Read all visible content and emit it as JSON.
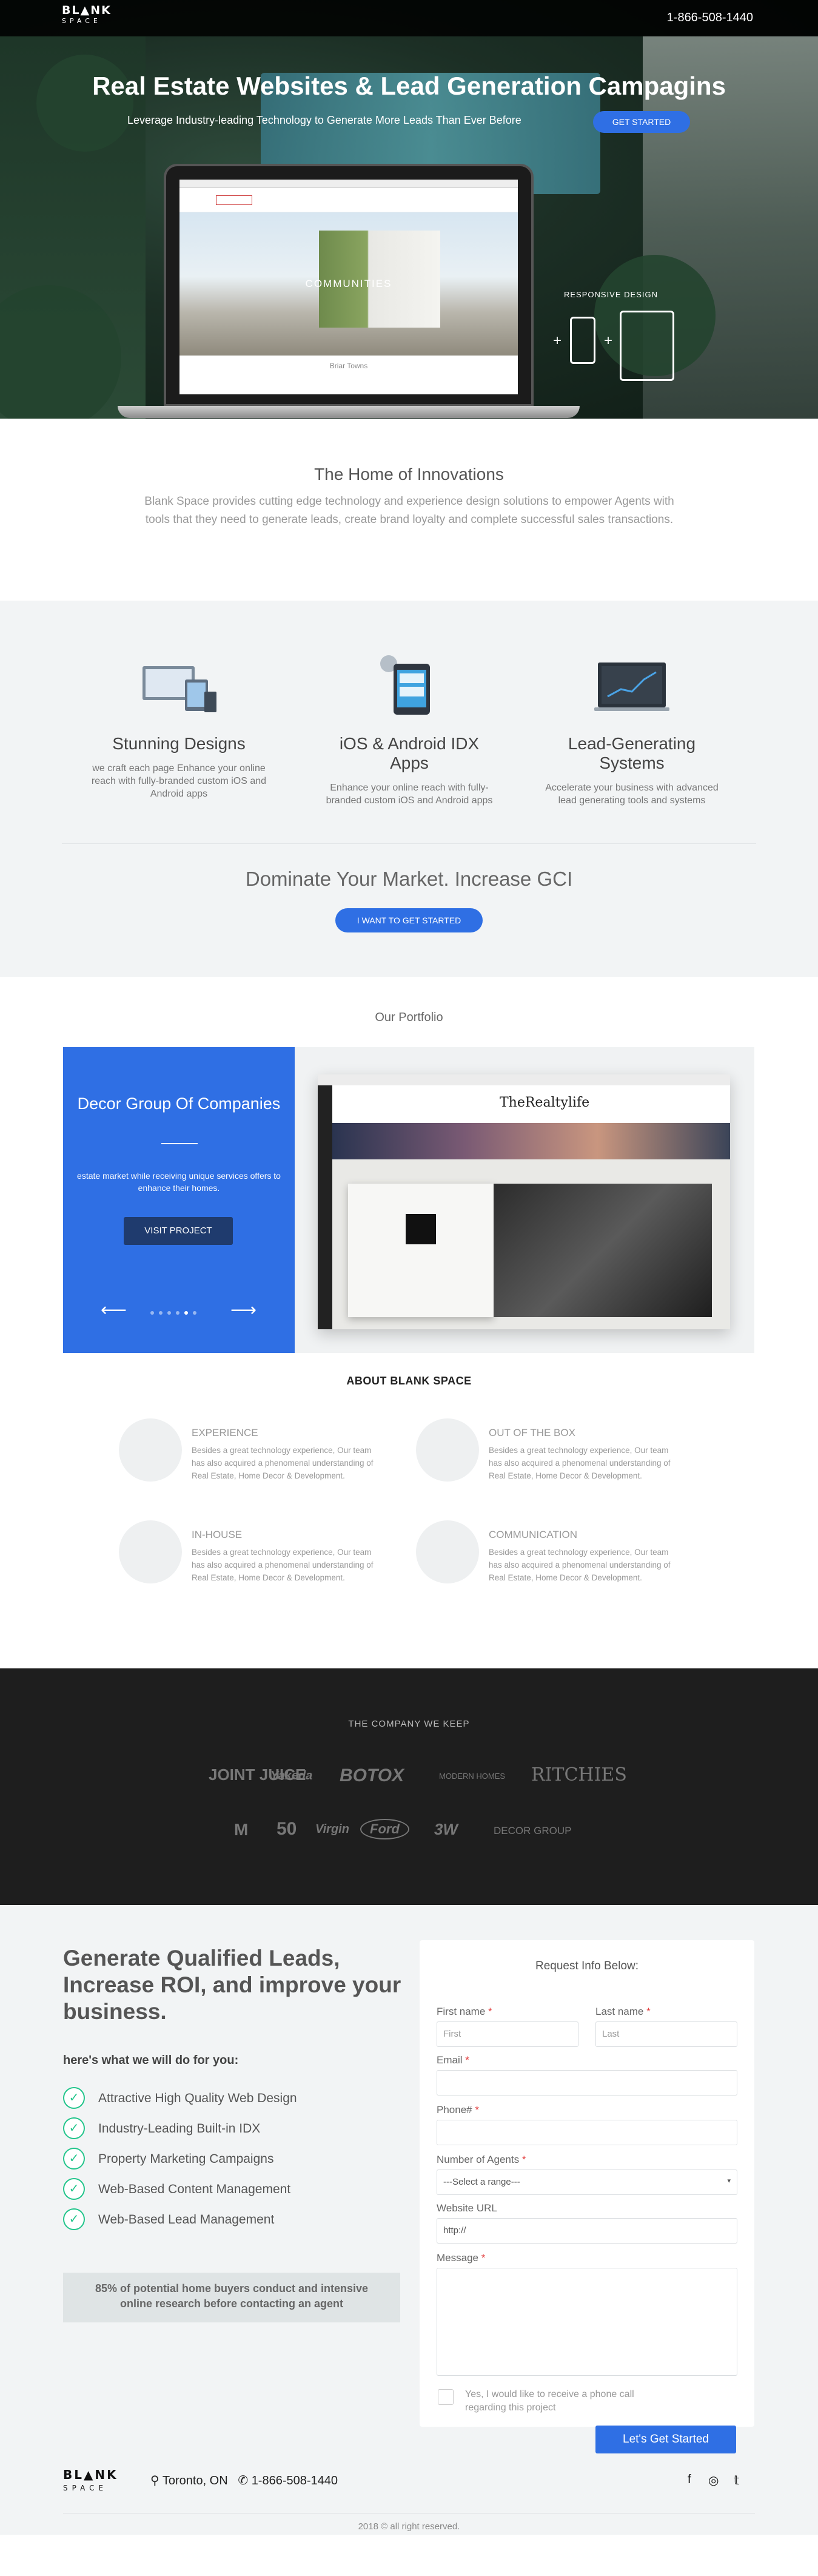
{
  "header": {
    "logo_top": "BL▲NK",
    "logo_bottom": "SPACE",
    "phone": "1-866-508-1440"
  },
  "hero": {
    "title": "Real Estate Websites & Lead Generation Campagins",
    "subtitle": "Leverage Industry-leading Technology to Generate More Leads Than Ever Before",
    "cta": "GET STARTED",
    "screen_heading": "COMMUNITIES",
    "screen_caption": "Briar Towns",
    "responsive_label": "RESPONSIVE DESIGN"
  },
  "innovations": {
    "title": "The Home of Innovations",
    "text": "Blank Space provides cutting edge technology and experience design solutions to empower Agents with tools that they need to generate leads, create brand loyalty and complete successful sales transactions."
  },
  "features": {
    "items": [
      {
        "title": "Stunning Designs",
        "text": "we craft each page Enhance your online reach with fully-branded custom iOS and Android apps"
      },
      {
        "title": "iOS & Android IDX Apps",
        "text": "Enhance your online reach with fully-branded custom iOS and Android apps"
      },
      {
        "title": "Lead-Generating Systems",
        "text": "Accelerate your business with advanced lead generating tools and systems"
      }
    ],
    "headline": "Dominate Your Market. Increase GCI",
    "cta": "I WANT TO GET STARTED"
  },
  "portfolio": {
    "title": "Our Portfolio",
    "project_title": "Decor Group Of Companies",
    "project_text": "estate market while receiving unique services offers to enhance their homes.",
    "button": "VISIT PROJECT",
    "prev": "⟵",
    "next": "⟶",
    "mock_brand": "TheRealtylife"
  },
  "about": {
    "title": "ABOUT BLANK SPACE",
    "items": [
      {
        "title": "EXPERIENCE",
        "text": "Besides a great technology experience, Our team has also acquired a phenomenal understanding of Real Estate, Home Decor & Development."
      },
      {
        "title": "OUT OF THE BOX",
        "text": "Besides a great technology experience, Our team has also acquired a phenomenal understanding of Real Estate, Home Decor & Development."
      },
      {
        "title": "IN-HOUSE",
        "text": "Besides a great technology experience, Our team has also acquired a phenomenal understanding of Real Estate, Home Decor & Development."
      },
      {
        "title": "COMMUNICATION",
        "text": "Besides a great technology experience, Our team has also acquired a phenomenal understanding of Real Estate, Home Decor & Development."
      }
    ]
  },
  "company": {
    "title": "THE COMPANY WE KEEP",
    "brands": [
      "JOINT JUICE",
      "Yakeda",
      "BOTOX",
      "MODERN HOMES",
      "RITCHIES",
      "M",
      "50",
      "Virgin",
      "Ford",
      "3W",
      "DECOR GROUP"
    ]
  },
  "lead": {
    "title": "Generate Qualified Leads, Increase ROI, and improve your business.",
    "we_do": "here's what we will do for you:",
    "items": [
      "Attractive High Quality Web Design",
      "Industry-Leading Built-in IDX",
      "Property Marketing Campaigns",
      "Web-Based Content Management",
      "Web-Based Lead Management"
    ],
    "stat": "85% of potential home buyers conduct and intensive online research before contacting an agent",
    "check": "✓"
  },
  "form": {
    "title": "Request Info Below:",
    "first_label": "First name",
    "first_ph": "First",
    "last_label": "Last name",
    "last_ph": "Last",
    "email_label": "Email",
    "phone_label": "Phone#",
    "agents_label": "Number of Agents",
    "agents_value": "---Select a range---",
    "website_label": "Website URL",
    "website_ph": "http://",
    "message_label": "Message",
    "required": "*",
    "callback": "Yes, I would like to receive a phone call regarding this project",
    "submit": "Let's Get Started"
  },
  "footer": {
    "logo_top": "BL▲NK",
    "logo_bottom": "SPACE",
    "location": "Toronto, ON",
    "phone": "1-866-508-1440",
    "copyright": "2018 © all right reserved.",
    "social": [
      "f",
      "◎",
      "𝕥"
    ]
  }
}
